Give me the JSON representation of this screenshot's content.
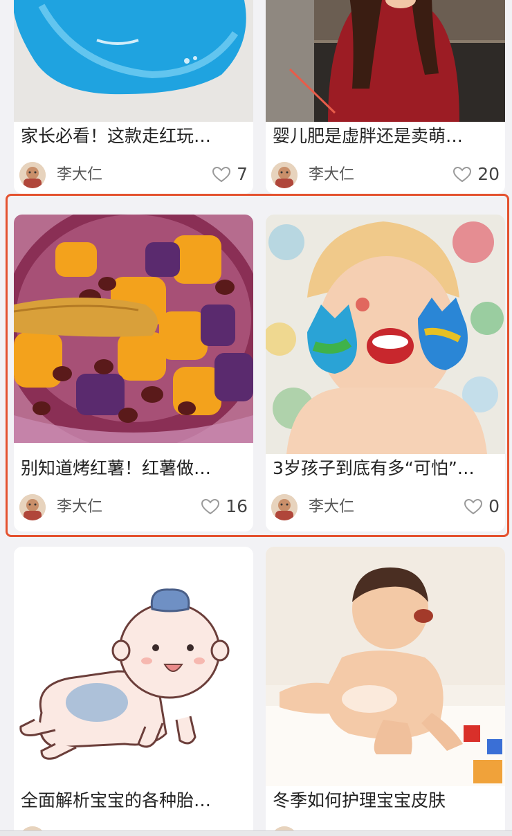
{
  "posts": [
    {
      "title": "家长必看！这款走红玩…",
      "author": "李大仁",
      "likes": "7"
    },
    {
      "title": "婴儿肥是虚胖还是卖萌…",
      "author": "李大仁",
      "likes": "20"
    },
    {
      "title": "别知道烤红薯！红薯做…",
      "author": "李大仁",
      "likes": "16"
    },
    {
      "title": "3岁孩子到底有多“可怕”…",
      "author": "李大仁",
      "likes": "0"
    },
    {
      "title": "全面解析宝宝的各种胎…"
    },
    {
      "title": "冬季如何护理宝宝皮肤"
    }
  ],
  "icons": {
    "like": "heart-outline-icon",
    "avatar": "author-avatar"
  },
  "colors": {
    "highlight": "#e4522f",
    "background": "#f2f2f5",
    "card": "#ffffff"
  }
}
